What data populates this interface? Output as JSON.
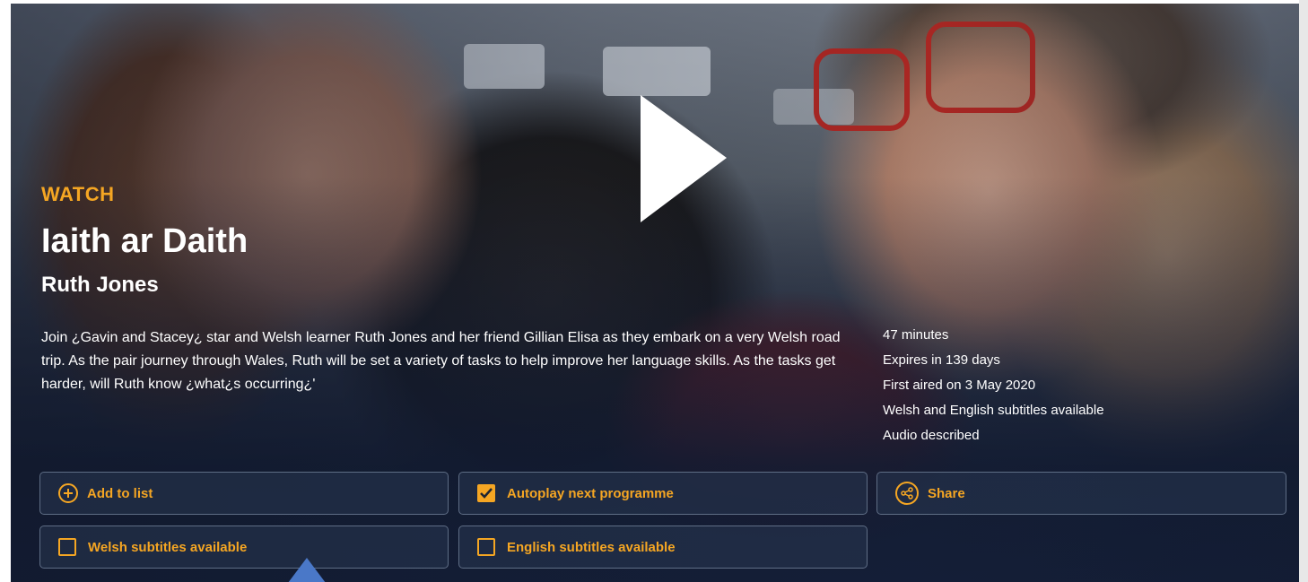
{
  "hero": {
    "watch_label": "WATCH",
    "title": "Iaith ar Daith",
    "subtitle": "Ruth Jones",
    "description": "Join ¿Gavin and Stacey¿ star and Welsh learner Ruth Jones and her friend Gillian Elisa as they embark on a very Welsh road trip. As the pair journey through Wales, Ruth will be set a variety of tasks to help improve her language skills. As the tasks get harder, will Ruth know ¿what¿s occurring¿'"
  },
  "meta": {
    "duration": "47 minutes",
    "expires": "Expires in 139 days",
    "first_aired": "First aired on 3 May 2020",
    "subtitles": "Welsh and English subtitles available",
    "audio": "Audio described"
  },
  "actions": {
    "add_to_list": "Add to list",
    "autoplay": "Autoplay next programme",
    "share": "Share",
    "welsh_subtitles": "Welsh subtitles available",
    "english_subtitles": "English subtitles available"
  },
  "state": {
    "autoplay_checked": true,
    "welsh_subtitles_checked": false,
    "english_subtitles_checked": false
  },
  "icons": {
    "play": "play-icon",
    "add": "plus-circle-icon",
    "check": "check-icon",
    "share": "share-icon"
  },
  "colors": {
    "accent": "#f5a623",
    "text": "#ffffff",
    "panel": "#15203a"
  }
}
